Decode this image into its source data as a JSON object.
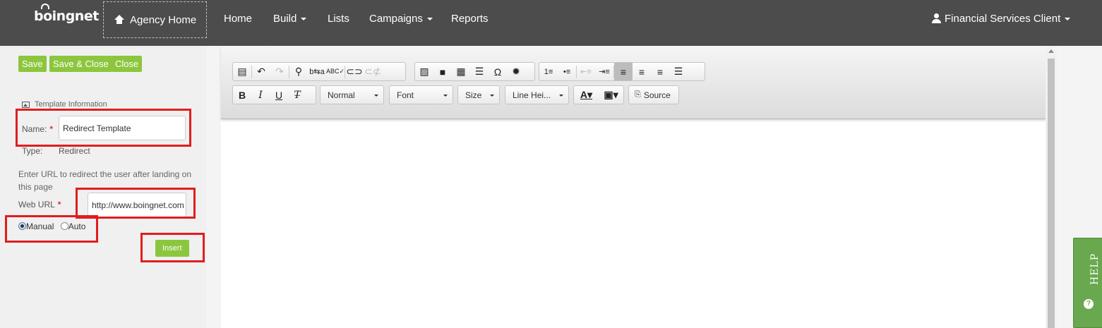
{
  "nav": {
    "logo": "boingnet",
    "agency_home": "Agency Home",
    "items": [
      "Home",
      "Build",
      "Lists",
      "Campaigns",
      "Reports"
    ],
    "user": "Financial Services Client"
  },
  "sidebar": {
    "buttons": {
      "save": "Save",
      "save_close": "Save & Close",
      "close": "Close"
    },
    "section_title": "Template Information",
    "name_label": "Name:",
    "required": "*",
    "name_value": "Redirect Template",
    "type_label": "Type:",
    "type_value": "Redirect",
    "help_text": "Enter URL to redirect the user after landing on this page",
    "web_url_label": "Web URL",
    "web_url_value": "http://www.boingnet.com",
    "radio_manual": "Manual",
    "radio_auto": "Auto",
    "insert": "Insert"
  },
  "editor": {
    "format_combo": "Normal",
    "font_combo": "Font",
    "size_combo": "Size",
    "line_height_combo": "Line Hei...",
    "source_button": "Source",
    "icons": {
      "paste": "clipboard-icon",
      "undo": "undo-icon",
      "redo": "redo-icon",
      "find": "search-icon",
      "replace": "replace-icon",
      "spellcheck": "spellcheck-icon",
      "link": "link-icon",
      "unlink": "unlink-icon",
      "image": "image-icon",
      "video": "video-icon",
      "table": "table-icon",
      "hr": "horizontal-rule-icon",
      "special_char": "omega-icon",
      "settings": "gear-icon"
    }
  },
  "help_tab": "HELP",
  "colors": {
    "navbar": "#4c4c4c",
    "green": "#8cc63e",
    "help_green": "#6aa84f",
    "highlight": "#e11d1d"
  }
}
